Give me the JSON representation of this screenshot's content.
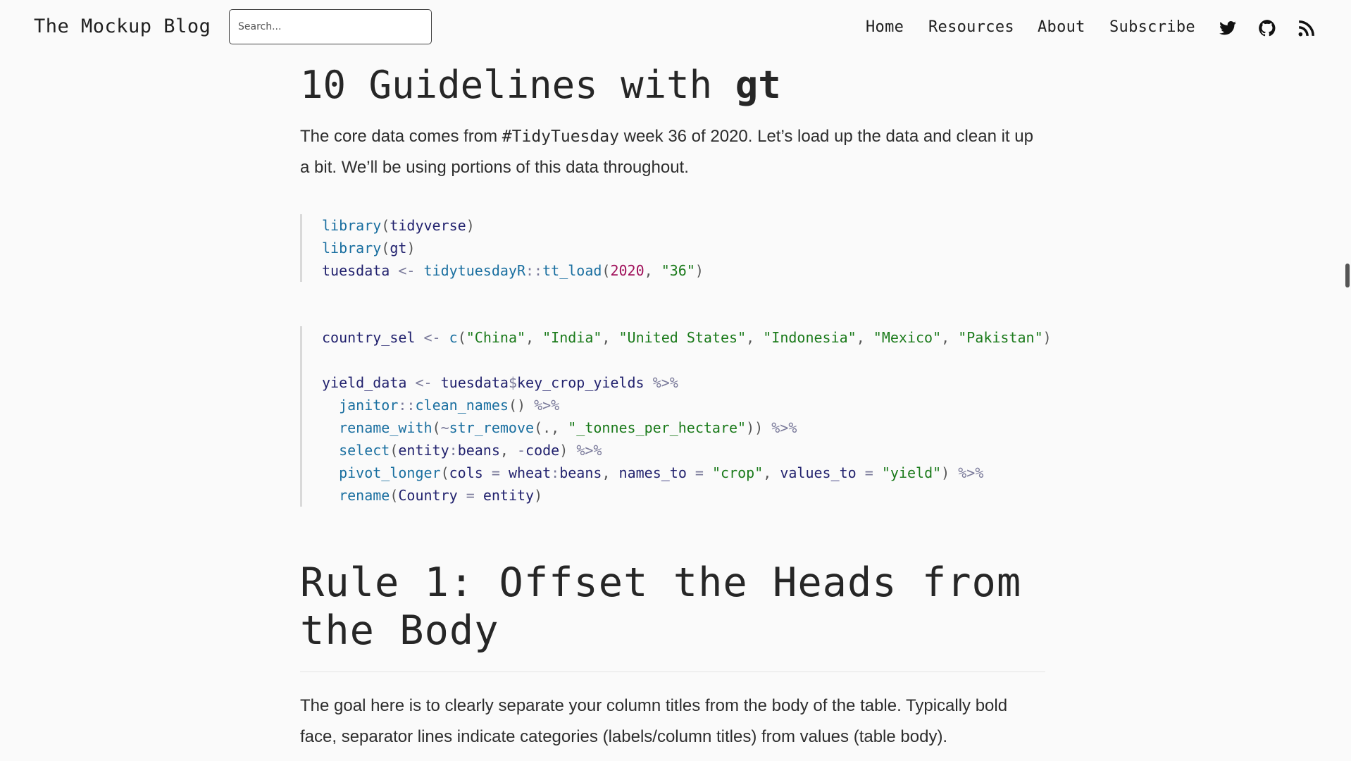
{
  "header": {
    "brand": "The Mockup Blog",
    "search_placeholder": "Search...",
    "nav": [
      "Home",
      "Resources",
      "About",
      "Subscribe"
    ],
    "icons": [
      "twitter-icon",
      "github-icon",
      "rss-icon"
    ]
  },
  "article": {
    "heading": "10 Guidelines with ",
    "heading_strong": "gt",
    "intro_before": "The core data comes from ",
    "intro_code": "#TidyTuesday",
    "intro_after": " week 36 of 2020. Let’s load up the data and clean it up a bit. We’ll be using portions of this data throughout.",
    "code1": [
      "library(tidyverse)",
      "library(gt)",
      "tuesdata <- tidytuesdayR::tt_load(2020, \"36\")"
    ],
    "code2": [
      "country_sel <- c(\"China\", \"India\", \"United States\", \"Indonesia\", \"Mexico\", \"Pakistan\")",
      "",
      "yield_data <- tuesdata$key_crop_yields %>%",
      "  janitor::clean_names() %>%",
      "  rename_with(~str_remove(., \"_tonnes_per_hectare\")) %>%",
      "  select(entity:beans, -code) %>%",
      "  pivot_longer(cols = wheat:beans, names_to = \"crop\", values_to = \"yield\") %>%",
      "  rename(Country = entity)"
    ],
    "rule1_heading": "Rule 1: Offset the Heads from the Body",
    "rule1_text": "The goal here is to clearly separate your column titles from the body of the table. Typically bold face, separator lines indicate categories (labels/column titles) from values (table body)."
  },
  "colors": {
    "background": "#fafafa",
    "text": "#2b2b2b",
    "string": "#1a7a1a",
    "number": "#a0105a",
    "function": "#1a6fa0"
  }
}
